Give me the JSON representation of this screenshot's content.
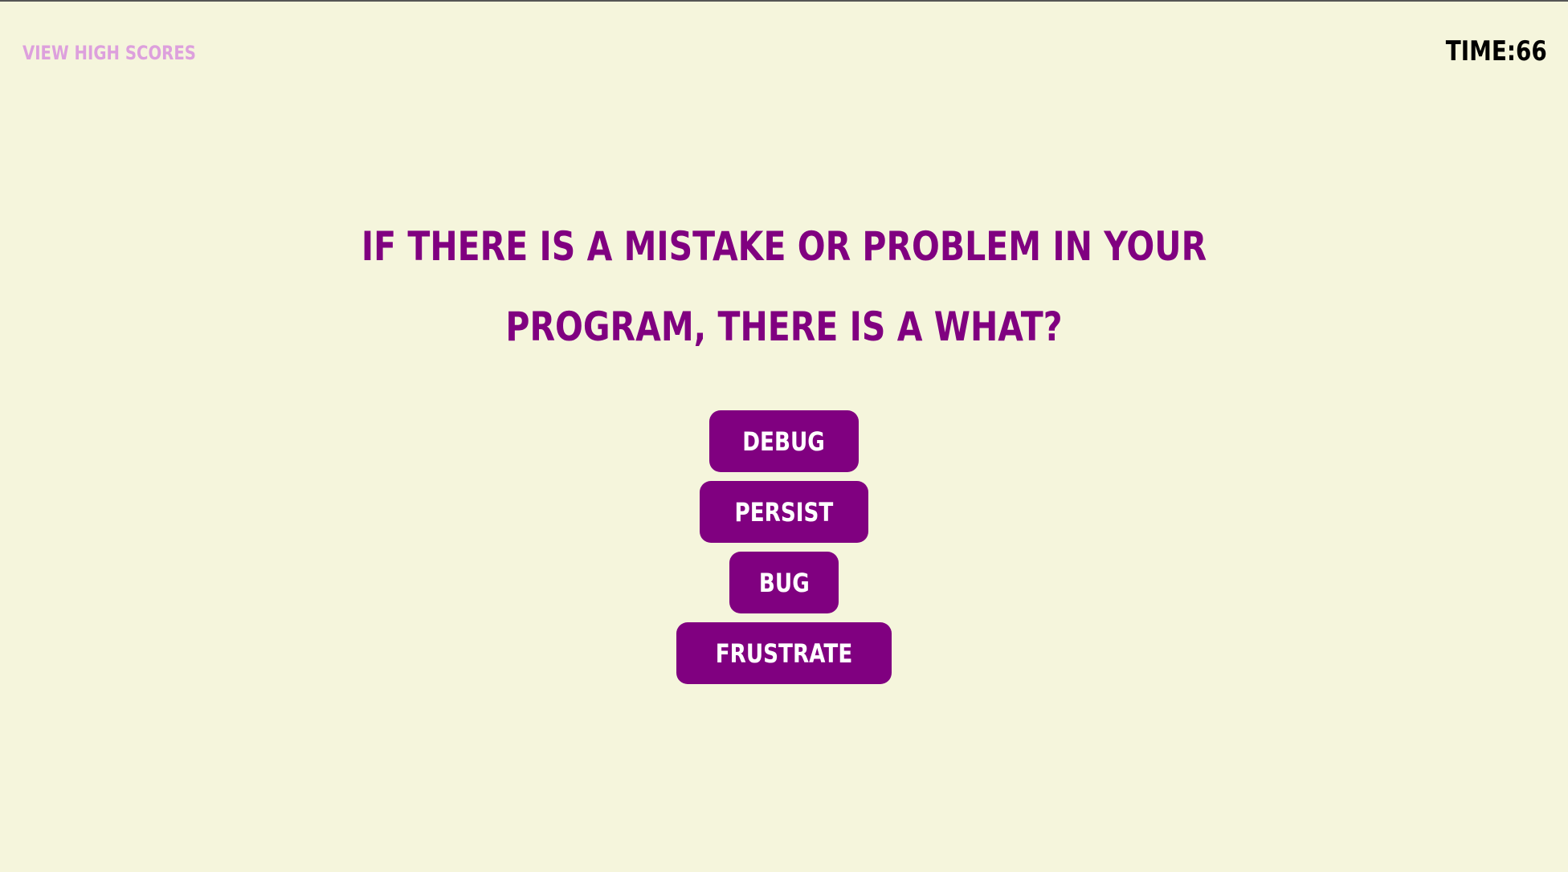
{
  "header": {
    "high_scores_label": "View High Scores",
    "timer_text": "Time:66"
  },
  "quiz": {
    "question": "If there is a mistake or problem in your program, there is a what?",
    "choices": [
      {
        "label": "debug"
      },
      {
        "label": "persist"
      },
      {
        "label": "bug"
      },
      {
        "label": "frustrate"
      }
    ]
  },
  "colors": {
    "background": "#f5f5dc",
    "accent": "#800080",
    "link": "#dda0dd",
    "button_text": "#ffffff",
    "timer": "#000000"
  }
}
